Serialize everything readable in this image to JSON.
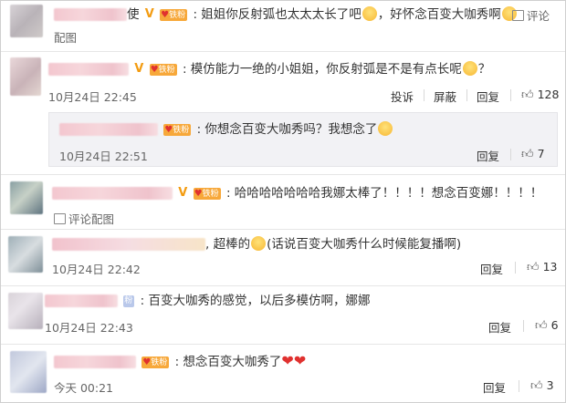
{
  "comments": [
    {
      "text": ": 姐姐你反射弧也太太太长了吧",
      "text2": "，好怀念百变大咖秀啊",
      "name_suffix": "使",
      "v": "V",
      "fan": "铁粉",
      "actions": [
        "评论",
        "配图"
      ]
    },
    {
      "text": ": 模仿能力一绝的小姐姐，你反射弧是不是有点长呢",
      "text2": "？",
      "v": "V",
      "fan": "铁粉",
      "time": "10月24日 22:45",
      "actions": [
        "投诉",
        "屏蔽",
        "回复"
      ],
      "likes": "128"
    },
    {
      "text": ": 你想念百变大咖秀吗？我想念了",
      "fan": "铁粉",
      "time": "10月24日 22:51",
      "actions": [
        "回复"
      ],
      "likes": "7"
    },
    {
      "text": ": 哈哈哈哈哈哈哈我娜太棒了！！！！想念百变娜！！！！",
      "v": "V",
      "fan": "铁粉",
      "actions": [
        "评论",
        "配图"
      ]
    },
    {
      "text": ", 超棒的",
      "text2": "(话说百变大咖秀什么时候能复播啊)",
      "time": "10月24日 22:42",
      "actions": [
        "回复"
      ],
      "likes": "13"
    },
    {
      "text": ": 百变大咖秀的感觉，以后多模仿啊，娜娜",
      "fan": "粉",
      "time": "10月24日 22:43",
      "actions": [
        "回复"
      ],
      "likes": "6"
    },
    {
      "text": ": 想念百变大咖秀了",
      "fan": "铁粉",
      "time": "今天 00:21",
      "actions": [
        "回复"
      ],
      "likes": "3"
    }
  ],
  "icons": {
    "like": "thumbs-up-icon",
    "emoji": "smiley-emoji-icon",
    "heart": "heart-emoji-icon",
    "picture": "picture-icon",
    "comment": "comment-icon"
  },
  "colors": {
    "fan_badge": "#f7a83a",
    "heart": "#e0312f",
    "vip": "#f39c12"
  }
}
